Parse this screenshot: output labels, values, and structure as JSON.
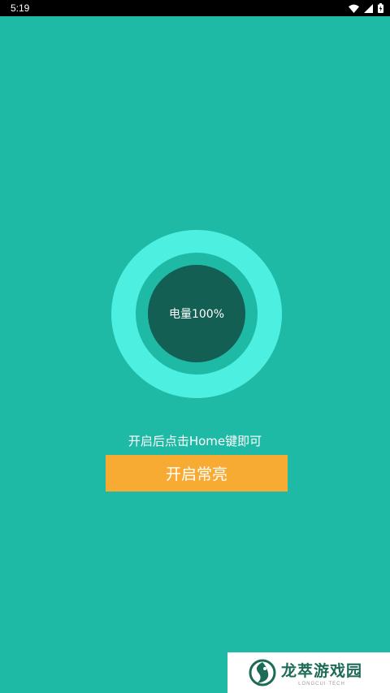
{
  "status_bar": {
    "time": "5:19",
    "icons": [
      "wifi-icon",
      "signal-icon",
      "battery-icon"
    ]
  },
  "main": {
    "battery_label": "电量100%",
    "hint": "开启后点击Home键即可",
    "button_label": "开启常亮"
  },
  "watermark": {
    "title": "龙萃游戏园",
    "subtitle": "LONGCUI·TECH"
  },
  "colors": {
    "background": "#1fbaa5",
    "ring_outer": "#4cefe0",
    "ring_inner": "#135f54",
    "button": "#f8ab32"
  }
}
